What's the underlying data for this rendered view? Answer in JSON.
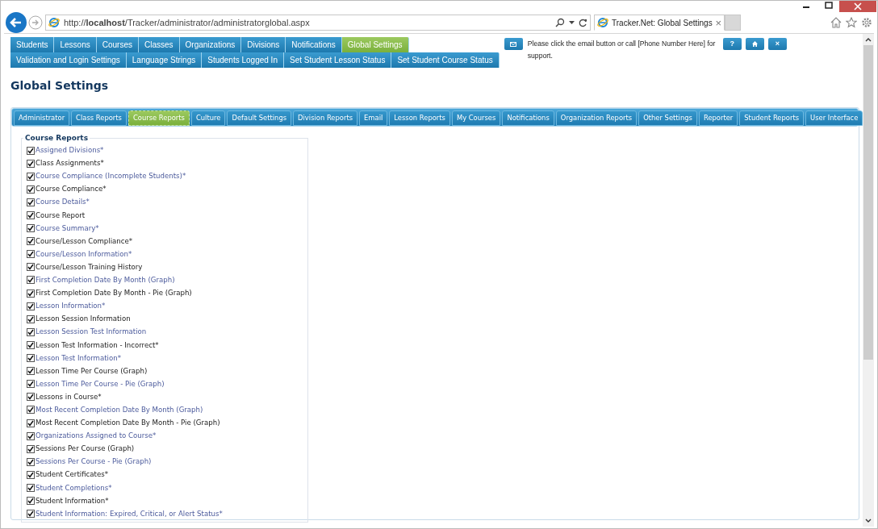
{
  "browser": {
    "url": "http://**localhost**/Tracker/administrator/administratorglobal.aspx",
    "tab_title": "Tracker.Net: Global Settings",
    "tab_close": "×"
  },
  "nav_rows": [
    [
      {
        "label": "Students",
        "selected": false
      },
      {
        "label": "Lessons",
        "selected": false
      },
      {
        "label": "Courses",
        "selected": false
      },
      {
        "label": "Classes",
        "selected": false
      },
      {
        "label": "Organizations",
        "selected": false
      },
      {
        "label": "Divisions",
        "selected": false
      },
      {
        "label": "Notifications",
        "selected": false
      },
      {
        "label": "Global Settings",
        "selected": true
      }
    ],
    [
      {
        "label": "Validation and Login Settings",
        "selected": false
      },
      {
        "label": "Language Strings",
        "selected": false
      },
      {
        "label": "Students Logged In",
        "selected": false
      },
      {
        "label": "Set Student Lesson Status",
        "selected": false
      },
      {
        "label": "Set Student Course Status",
        "selected": false
      }
    ]
  ],
  "support": {
    "text": "Please click the email button or call [Phone Number Here] for support.",
    "buttons": [
      {
        "kind": "help",
        "label": "?"
      },
      {
        "kind": "home"
      },
      {
        "kind": "close",
        "label": "×"
      }
    ]
  },
  "heading": "Global Settings",
  "settings_tabs": [
    {
      "label": "Administrator",
      "selected": false
    },
    {
      "label": "Class Reports",
      "selected": false
    },
    {
      "label": "Course Reports",
      "selected": true
    },
    {
      "label": "Culture",
      "selected": false
    },
    {
      "label": "Default Settings",
      "selected": false
    },
    {
      "label": "Division Reports",
      "selected": false
    },
    {
      "label": "Email",
      "selected": false
    },
    {
      "label": "Lesson Reports",
      "selected": false
    },
    {
      "label": "My Courses",
      "selected": false
    },
    {
      "label": "Notifications",
      "selected": false
    },
    {
      "label": "Organization Reports",
      "selected": false
    },
    {
      "label": "Other Settings",
      "selected": false
    },
    {
      "label": "Reporter",
      "selected": false
    },
    {
      "label": "Student Reports",
      "selected": false
    },
    {
      "label": "User Interface",
      "selected": false
    }
  ],
  "group": {
    "legend": "Course Reports",
    "items": [
      {
        "label": "Assigned Divisions*",
        "checked": true
      },
      {
        "label": "Class Assignments*",
        "checked": true
      },
      {
        "label": "Course Compliance (Incomplete Students)*",
        "checked": true
      },
      {
        "label": "Course Compliance*",
        "checked": true
      },
      {
        "label": "Course Details*",
        "checked": true
      },
      {
        "label": "Course Report",
        "checked": true
      },
      {
        "label": "Course Summary*",
        "checked": true
      },
      {
        "label": "Course/Lesson Compliance*",
        "checked": true
      },
      {
        "label": "Course/Lesson Information*",
        "checked": true
      },
      {
        "label": "Course/Lesson Training History",
        "checked": true
      },
      {
        "label": "First Completion Date By Month (Graph)",
        "checked": true
      },
      {
        "label": "First Completion Date By Month - Pie (Graph)",
        "checked": true
      },
      {
        "label": "Lesson Information*",
        "checked": true
      },
      {
        "label": "Lesson Session Information",
        "checked": true
      },
      {
        "label": "Lesson Session Test Information",
        "checked": true
      },
      {
        "label": "Lesson Test Information - Incorrect*",
        "checked": true
      },
      {
        "label": "Lesson Test Information*",
        "checked": true
      },
      {
        "label": "Lesson Time Per Course (Graph)",
        "checked": true
      },
      {
        "label": "Lesson Time Per Course - Pie (Graph)",
        "checked": true
      },
      {
        "label": "Lessons in Course*",
        "checked": true
      },
      {
        "label": "Most Recent Completion Date By Month (Graph)",
        "checked": true
      },
      {
        "label": "Most Recent Completion Date By Month - Pie (Graph)",
        "checked": true
      },
      {
        "label": "Organizations Assigned to Course*",
        "checked": true
      },
      {
        "label": "Sessions Per Course (Graph)",
        "checked": true
      },
      {
        "label": "Sessions Per Course - Pie (Graph)",
        "checked": true
      },
      {
        "label": "Student Certificates*",
        "checked": true
      },
      {
        "label": "Student Completions*",
        "checked": true
      },
      {
        "label": "Student Information*",
        "checked": true
      },
      {
        "label": "Student Information: Expired, Critical, or Alert Status*",
        "checked": true
      }
    ]
  }
}
